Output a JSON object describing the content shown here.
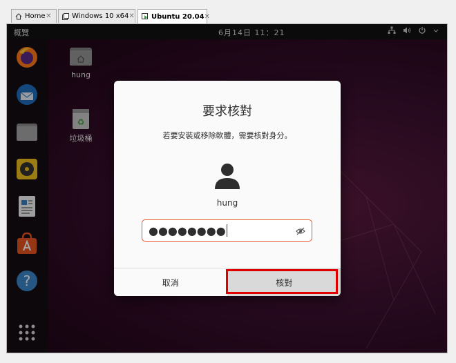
{
  "tabs": [
    {
      "label": "Home",
      "icon": "home-icon",
      "active": false
    },
    {
      "label": "Windows 10 x64",
      "icon": "vm-icon",
      "active": false
    },
    {
      "label": "Ubuntu 20.04",
      "icon": "vm-running-icon",
      "active": true
    }
  ],
  "topbar": {
    "activities": "概覽",
    "clock": "6月14日  11：21"
  },
  "desktop": {
    "icons": [
      {
        "label": "hung",
        "icon": "home-folder-icon"
      },
      {
        "label": "垃圾桶",
        "icon": "trash-icon"
      }
    ]
  },
  "dock": {
    "apps": [
      "firefox-icon",
      "thunderbird-icon",
      "files-icon",
      "rhythmbox-icon",
      "writer-icon",
      "software-icon",
      "help-icon",
      "show-apps-icon"
    ]
  },
  "dialog": {
    "title": "要求核對",
    "subtitle": "若要安裝或移除軟體，需要核對身分。",
    "username": "hung",
    "password_masked": "●●●●●●●●",
    "cancel_label": "取消",
    "confirm_label": "核對"
  },
  "colors": {
    "accent": "#e95420",
    "highlight": "#e00000"
  }
}
